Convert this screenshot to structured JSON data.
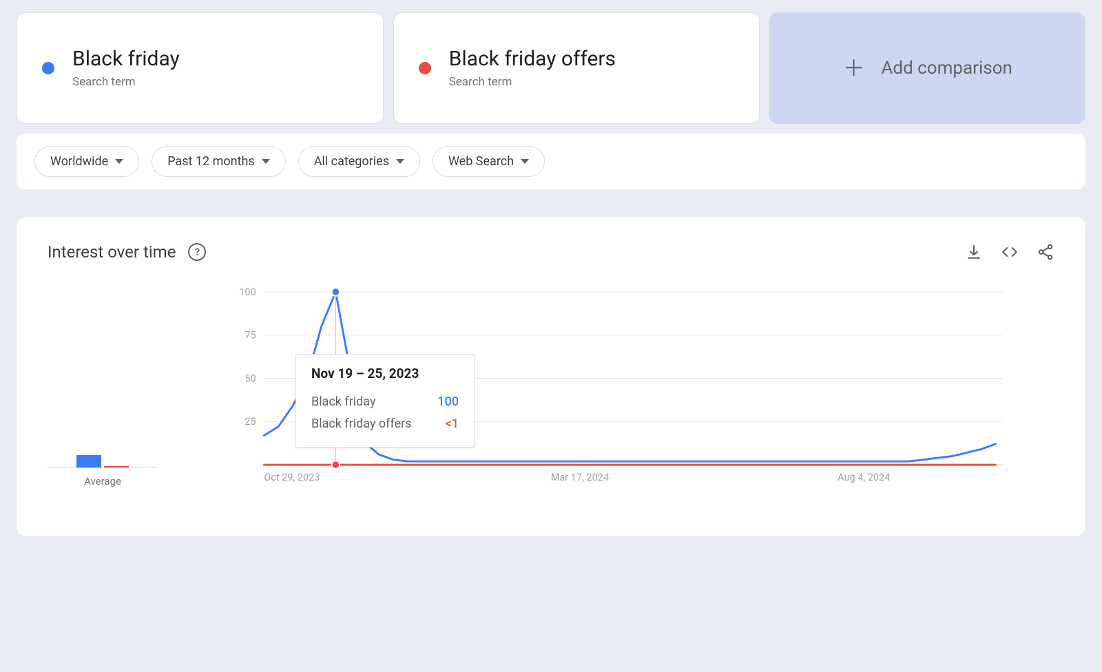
{
  "colors": {
    "series1": "#3b7cf5",
    "series2": "#eb4c42",
    "text_muted": "#70757a"
  },
  "terms": [
    {
      "label": "Black friday",
      "sub": "Search term",
      "color": "#3b7cf5"
    },
    {
      "label": "Black friday offers",
      "sub": "Search term",
      "color": "#eb4c42"
    }
  ],
  "add_comparison_label": "Add comparison",
  "filters": {
    "region": "Worldwide",
    "period": "Past 12 months",
    "category": "All categories",
    "surface": "Web Search"
  },
  "panel": {
    "title": "Interest over time",
    "avg_label": "Average"
  },
  "tooltip": {
    "title": "Nov 19 – 25, 2023",
    "rows": [
      {
        "name": "Black friday",
        "value": "100",
        "color": "#3b7cf5"
      },
      {
        "name": "Black friday offers",
        "value": "<1",
        "color": "#eb4c42"
      }
    ]
  },
  "chart_data": {
    "type": "line",
    "ylabel": "",
    "ylim": [
      0,
      100
    ],
    "y_ticks": [
      25,
      50,
      75,
      100
    ],
    "x_tick_labels": [
      "Oct 29, 2023",
      "Mar 17, 2024",
      "Aug 4, 2024"
    ],
    "x_tick_positions": [
      0,
      20,
      40
    ],
    "series": [
      {
        "name": "Black friday",
        "color": "#3b7cf5",
        "average": 7,
        "values": [
          17,
          22,
          34,
          50,
          80,
          100,
          55,
          13,
          6,
          3,
          2,
          2,
          2,
          2,
          2,
          2,
          2,
          2,
          2,
          2,
          2,
          2,
          2,
          2,
          2,
          2,
          2,
          2,
          2,
          2,
          2,
          2,
          2,
          2,
          2,
          2,
          2,
          2,
          2,
          2,
          2,
          2,
          2,
          2,
          2,
          2,
          3,
          4,
          5,
          7,
          9,
          12
        ]
      },
      {
        "name": "Black friday offers",
        "color": "#eb4c42",
        "average": 0.3,
        "values": [
          0,
          0,
          0,
          0,
          0,
          0,
          0,
          0,
          0,
          0,
          0,
          0,
          0,
          0,
          0,
          0,
          0,
          0,
          0,
          0,
          0,
          0,
          0,
          0,
          0,
          0,
          0,
          0,
          0,
          0,
          0,
          0,
          0,
          0,
          0,
          0,
          0,
          0,
          0,
          0,
          0,
          0,
          0,
          0,
          0,
          0,
          0,
          0,
          0,
          0,
          0,
          0
        ]
      }
    ],
    "highlight_index": 5
  }
}
